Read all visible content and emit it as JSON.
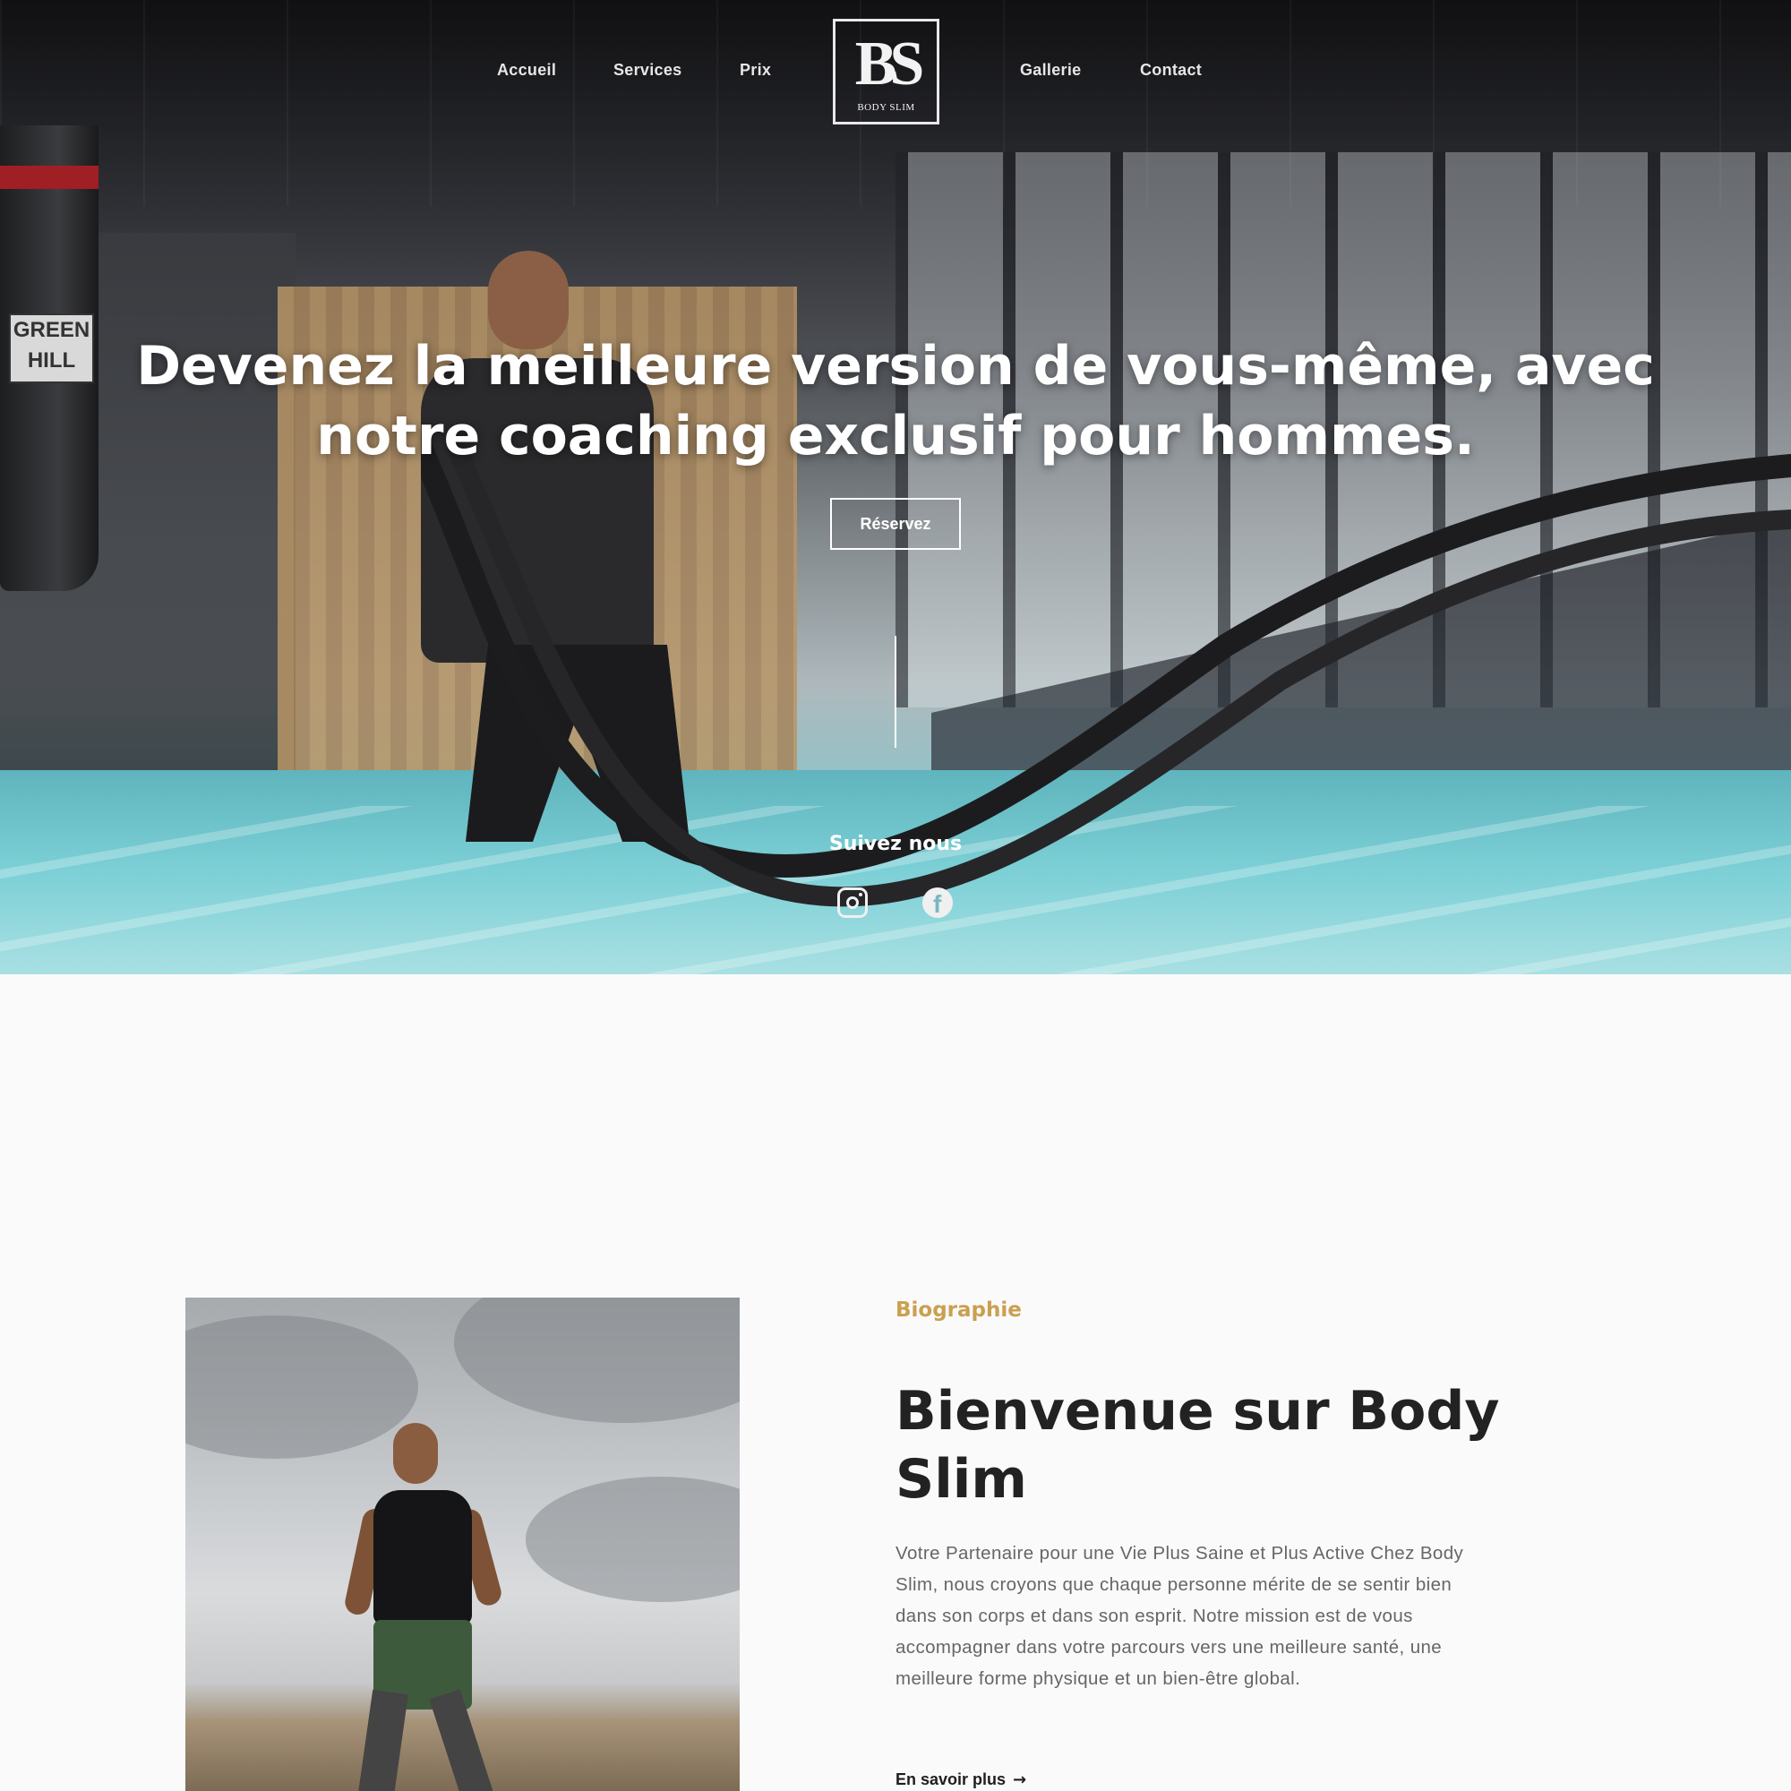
{
  "nav": {
    "items_left": [
      "Accueil",
      "Services",
      "Prix"
    ],
    "items_right": [
      "Gallerie",
      "Contact"
    ]
  },
  "logo": {
    "mark": "BS",
    "text": "BODY SLIM"
  },
  "hero": {
    "title": "Devenez la meilleure version de vous-même, avec notre coaching exclusif pour hommes.",
    "cta_label": "Réservez",
    "follow_label": "Suivez nous",
    "social_icons": [
      "instagram-icon",
      "facebook-icon"
    ],
    "sign_text": "GREEN HILL"
  },
  "about": {
    "eyebrow": "Biographie",
    "title": "Bienvenue sur Body Slim",
    "text": "Votre Partenaire pour une Vie Plus Saine et Plus Active Chez Body Slim, nous croyons que chaque personne mérite de se sentir bien dans son corps et dans son esprit. Notre mission est de vous accompagner dans votre parcours vers une meilleure santé, une meilleure forme physique et un bien-être global.",
    "more_label": "En savoir plus",
    "more_icon": "arrow-right-icon"
  },
  "colors": {
    "accent": "#c9a04f",
    "heading": "#222222",
    "body_text": "#666666"
  }
}
